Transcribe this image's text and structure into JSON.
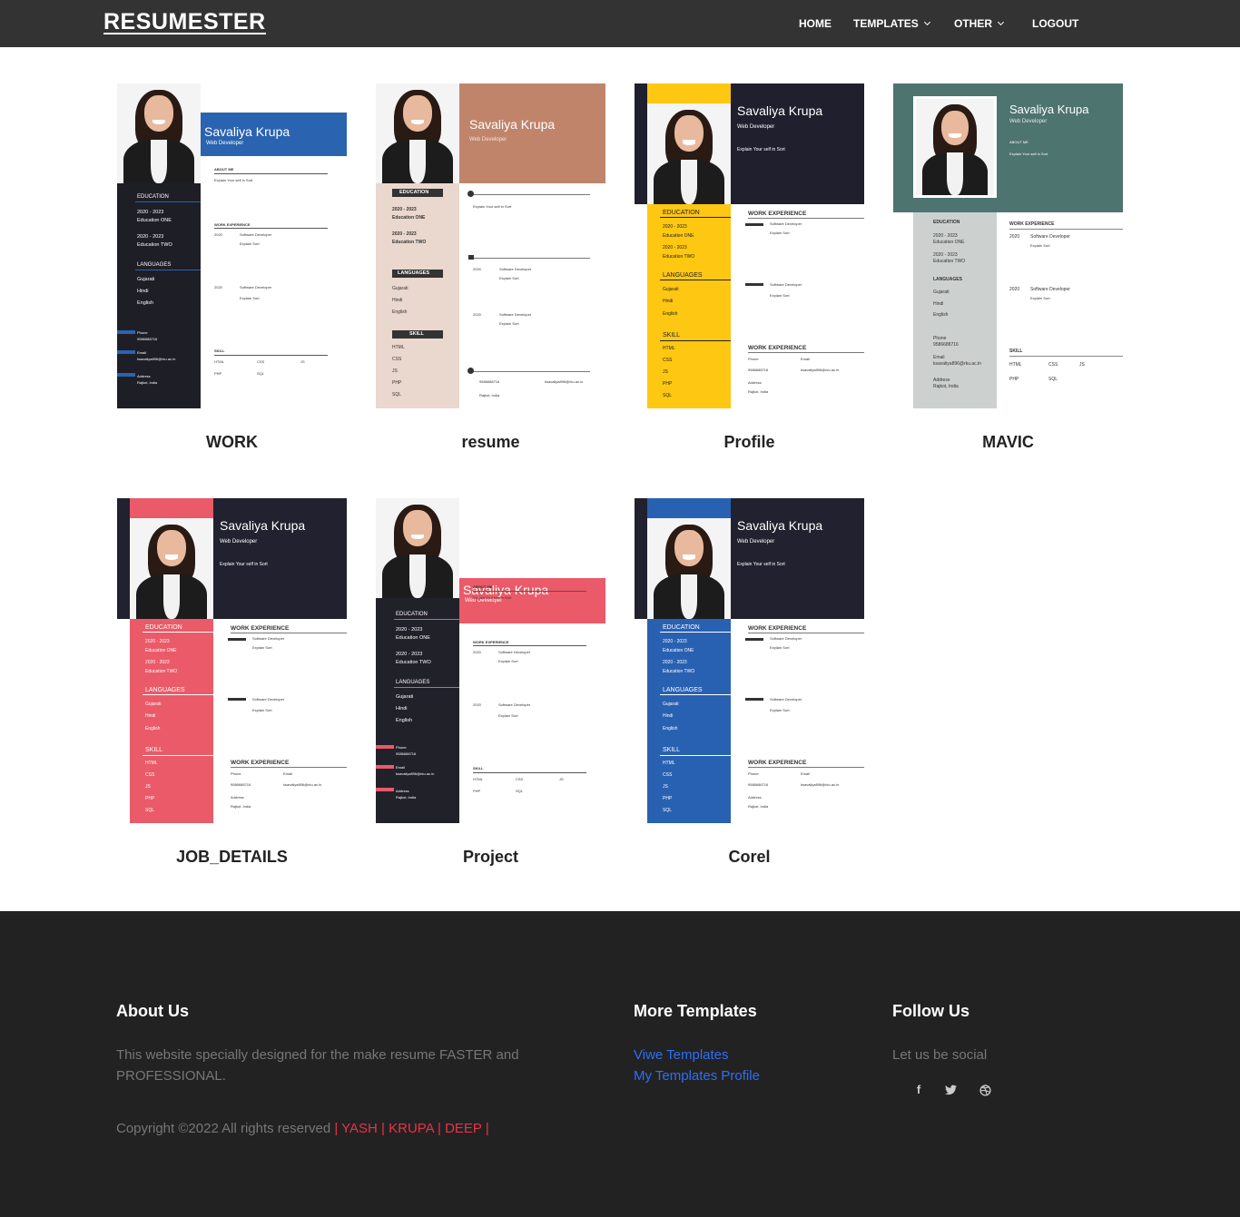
{
  "nav": {
    "logo": "RESUMESTER",
    "home": "HOME",
    "templates": "TEMPLATES",
    "other": "OTHER",
    "logout": "LOGOUT"
  },
  "resume": {
    "name": "Savaliya Krupa",
    "role": "Web Developer",
    "about": "Explain Your self in Sort",
    "about_me": "ABOUT ME",
    "education": "EDUCATION",
    "ed1_year": "2020 - 2023",
    "ed1": "Education ONE",
    "ed2_year": "2020 - 2023",
    "ed2": "Education TWO",
    "languages": "LANGUAGES",
    "lang1": "Gujarati",
    "lang2": "Hindi",
    "lang3": "English",
    "skill": "SKILL",
    "skills": [
      "HTML",
      "CSS",
      "JS",
      "PHP",
      "SQL"
    ],
    "work": "WORK EXPERIENCE",
    "work_year": "2020",
    "job": "Software Developer",
    "job_desc": "Explain Sort",
    "phone_label": "Phone",
    "phone": "9586688716",
    "email_label": "Email",
    "email": "ksavaliya896@rku.ac.in",
    "address_label": "Address",
    "address": "Rajkot, India"
  },
  "templates": [
    {
      "title": "WORK",
      "accent": "#2a63b0",
      "side": "#1e1e26"
    },
    {
      "title": "resume",
      "accent": "#c0846b",
      "side": "#ead7cd"
    },
    {
      "title": "Profile",
      "accent": "#fec712",
      "side": "#1f1f2e"
    },
    {
      "title": "MAVIC",
      "accent": "#4e7470",
      "side": "#ccd0cf"
    },
    {
      "title": "JOB_DETAILS",
      "accent": "#ea5a68",
      "side": "#21212f"
    },
    {
      "title": "Project",
      "accent": "#ea5a68",
      "side": "#21212a"
    },
    {
      "title": "Corel",
      "accent": "#2961b2",
      "side": "#21212f"
    }
  ],
  "footer": {
    "about_title": "About Us",
    "about_text": "This website specially designed for the make resume FASTER and PROFESSIONAL.",
    "copyright": "Copyright ©2022 All rights reserved",
    "authors": "| YASH | KRUPA | DEEP |",
    "more_title": "More Templates",
    "link1": "Viwe Templates",
    "link2": "My Templates Profile",
    "follow_title": "Follow Us",
    "social_text": "Let us be social",
    "social_icons": [
      "facebook-icon",
      "twitter-icon",
      "dribbble-icon"
    ]
  }
}
